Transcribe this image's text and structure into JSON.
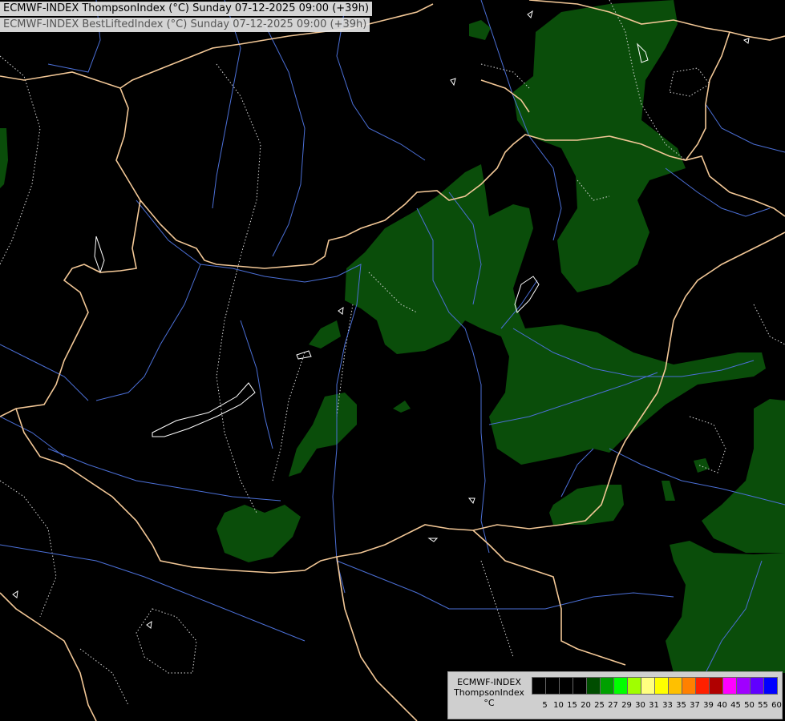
{
  "header": {
    "line1": "ECMWF-INDEX ThompsonIndex (°C) Sunday 07-12-2025 09:00 (+39h)",
    "line2": "ECMWF-INDEX BestLiftedIndex (°C) Sunday 07-12-2025 09:00 (+39h)"
  },
  "legend": {
    "title_lines": [
      "ECMWF-INDEX",
      "ThompsonIndex",
      "°C"
    ],
    "labels": [
      "5",
      "10",
      "15",
      "20",
      "25",
      "27",
      "29",
      "30",
      "31",
      "33",
      "35",
      "37",
      "39",
      "40",
      "45",
      "50",
      "55",
      "60"
    ],
    "colors": [
      "#000000",
      "#000000",
      "#000000",
      "#000000",
      "#004d00",
      "#00a000",
      "#00ff00",
      "#a0ff00",
      "#ffff80",
      "#ffff00",
      "#ffc000",
      "#ff8000",
      "#ff2000",
      "#b00000",
      "#ff00ff",
      "#a000ff",
      "#6000ff",
      "#0000ff"
    ]
  },
  "colors": {
    "shading": "#0a4d0a",
    "border": "#f2c796",
    "river": "#4b6fd6",
    "isoline": "#d8d8d8"
  }
}
